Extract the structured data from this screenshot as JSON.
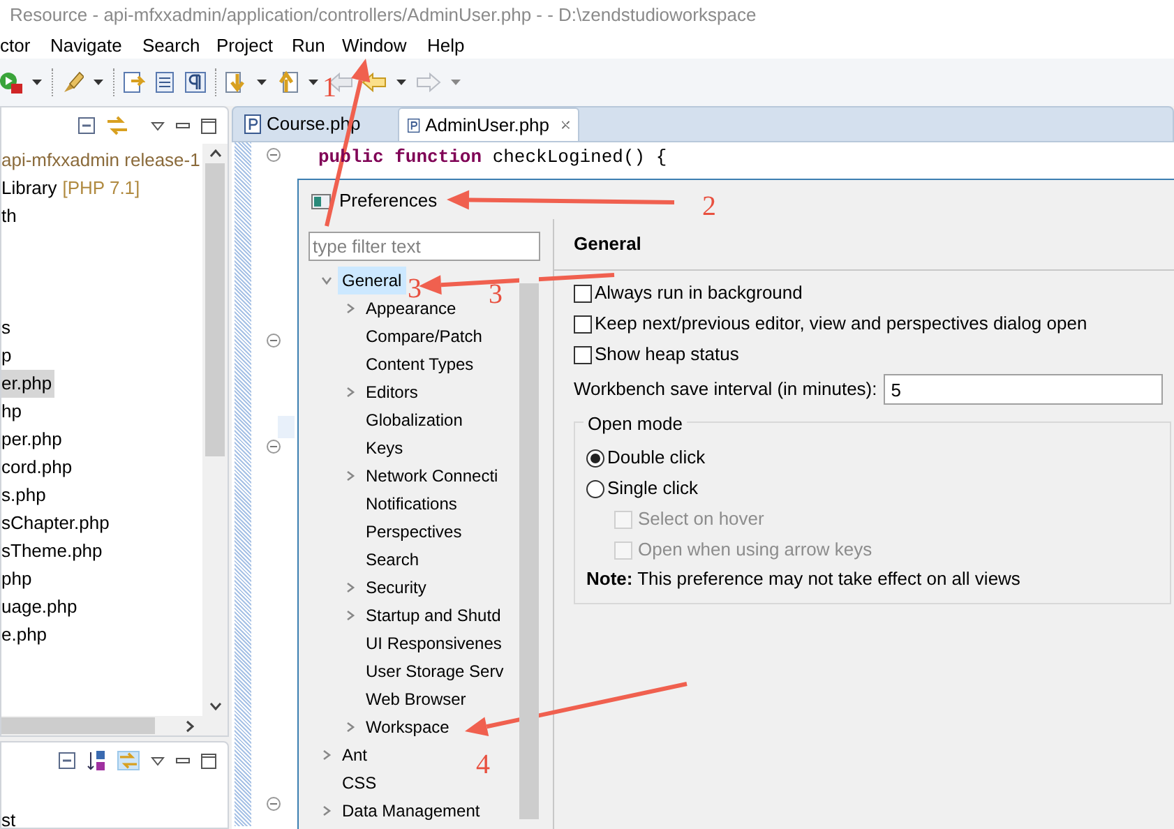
{
  "window": {
    "title": "Resource - api-mfxxadmin/application/controllers/AdminUser.php -  - D:\\zendstudioworkspace"
  },
  "menu": [
    "ctor",
    "Navigate",
    "Search",
    "Project",
    "Run",
    "Window",
    "Help"
  ],
  "explorer": {
    "items": [
      {
        "label": "api-mfxxadmin release-1",
        "kind": "project",
        "selected": false
      },
      {
        "label": "Library",
        "suffix": "[PHP 7.1]",
        "kind": "file",
        "selected": false
      },
      {
        "label": "th",
        "kind": "file",
        "selected": false
      },
      {
        "label": "s",
        "kind": "file",
        "selected": false
      },
      {
        "label": "p",
        "kind": "file",
        "selected": false
      },
      {
        "label": "er.php",
        "kind": "file",
        "selected": true
      },
      {
        "label": "hp",
        "kind": "file",
        "selected": false
      },
      {
        "label": "per.php",
        "kind": "file",
        "selected": false
      },
      {
        "label": "cord.php",
        "kind": "file",
        "selected": false
      },
      {
        "label": "s.php",
        "kind": "file",
        "selected": false
      },
      {
        "label": "sChapter.php",
        "kind": "file",
        "selected": false
      },
      {
        "label": "sTheme.php",
        "kind": "file",
        "selected": false
      },
      {
        "label": "php",
        "kind": "file",
        "selected": false
      },
      {
        "label": "uage.php",
        "kind": "file",
        "selected": false
      },
      {
        "label": "e.php",
        "kind": "file",
        "selected": false
      }
    ]
  },
  "outline": {
    "items": [
      "st"
    ]
  },
  "editor": {
    "tabs": [
      {
        "label": "Course.php",
        "selected": false
      },
      {
        "label": "AdminUser.php",
        "selected": true
      }
    ],
    "code": [
      {
        "kind": "keyword",
        "text": "public function"
      },
      {
        "kind": "plain",
        "text": " checkLogined() {"
      }
    ]
  },
  "preferences": {
    "title": "Preferences",
    "filter": {
      "placeholder": "type filter text"
    },
    "tree": [
      {
        "label": "General",
        "selected": true,
        "expanded": true,
        "children": [
          {
            "label": "Appearance",
            "has_children": true
          },
          {
            "label": "Compare/Patch",
            "has_children": false
          },
          {
            "label": "Content Types",
            "has_children": false
          },
          {
            "label": "Editors",
            "has_children": true
          },
          {
            "label": "Globalization",
            "has_children": false
          },
          {
            "label": "Keys",
            "has_children": false
          },
          {
            "label": "Network Connecti",
            "has_children": true
          },
          {
            "label": "Notifications",
            "has_children": false
          },
          {
            "label": "Perspectives",
            "has_children": false
          },
          {
            "label": "Search",
            "has_children": false
          },
          {
            "label": "Security",
            "has_children": true
          },
          {
            "label": "Startup and Shutd",
            "has_children": true
          },
          {
            "label": "UI Responsivenes",
            "has_children": false
          },
          {
            "label": "User Storage Serv",
            "has_children": false
          },
          {
            "label": "Web Browser",
            "has_children": false
          },
          {
            "label": "Workspace",
            "has_children": true
          }
        ]
      },
      {
        "label": "Ant",
        "selected": false,
        "has_children": true
      },
      {
        "label": "CSS",
        "selected": false,
        "has_children": false
      },
      {
        "label": "Data Management",
        "selected": false,
        "has_children": true
      }
    ],
    "page": {
      "title": "General",
      "options": [
        {
          "label": "Always run in background",
          "checked": false
        },
        {
          "label": "Keep next/previous editor, view and perspectives dialog open",
          "checked": false
        },
        {
          "label": "Show heap status",
          "checked": false
        }
      ],
      "interval": {
        "label": "Workbench save interval (in minutes):",
        "value": "5"
      },
      "open_mode": {
        "title": "Open mode",
        "radios": [
          {
            "label": "Double click",
            "selected": true
          },
          {
            "label": "Single click",
            "selected": false
          }
        ],
        "sub_options": [
          {
            "label": "Select on hover",
            "checked": false,
            "disabled": true
          },
          {
            "label": "Open when using arrow keys",
            "checked": false,
            "disabled": true
          }
        ],
        "note": "**Note:** This preference may not take effect on all views"
      }
    }
  },
  "annotations": [
    "1",
    "2",
    "3",
    "3",
    "4"
  ]
}
